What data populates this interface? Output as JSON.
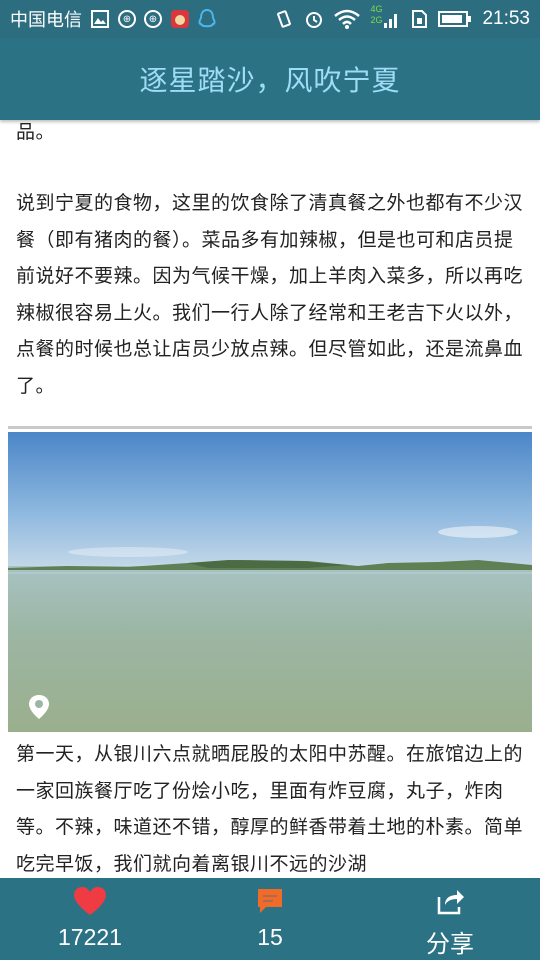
{
  "statusbar": {
    "carrier": "中国电信",
    "network_4g": "4G",
    "network_2g": "2G",
    "time": "21:53",
    "icons": [
      "gallery-icon",
      "notification-icon",
      "notification-icon",
      "app-icon",
      "qq-icon",
      "vibrate-icon",
      "alarm-icon",
      "wifi-icon",
      "signal-icon",
      "sim-icon",
      "battery-icon"
    ]
  },
  "header": {
    "title": "逐星踏沙，风吹宁夏"
  },
  "content": {
    "fragment": "品。",
    "paragraph_food": "说到宁夏的食物，这里的饮食除了清真餐之外也都有不少汉餐（即有猪肉的餐）。菜品多有加辣椒，但是也可和店员提前说好不要辣。因为气候干燥，加上羊肉入菜多，所以再吃辣椒很容易上火。我们一行人除了经常和王老吉下火以外，点餐的时候也总让店员少放点辣。但尽管如此，还是流鼻血了。",
    "paragraph_day1": "第一天，从银川六点就晒屁股的太阳中苏醒。在旅馆边上的一家回族餐厅吃了份烩小吃，里面有炸豆腐，丸子，炸肉等。不辣，味道还不错，醇厚的鲜香带着土地的朴素。简单吃完早饭，我们就向着离银川不远的沙湖"
  },
  "bottombar": {
    "likes": "17221",
    "comments": "15",
    "share_label": "分享",
    "like_color": "#ef3b42",
    "comment_color": "#f06a2a"
  }
}
